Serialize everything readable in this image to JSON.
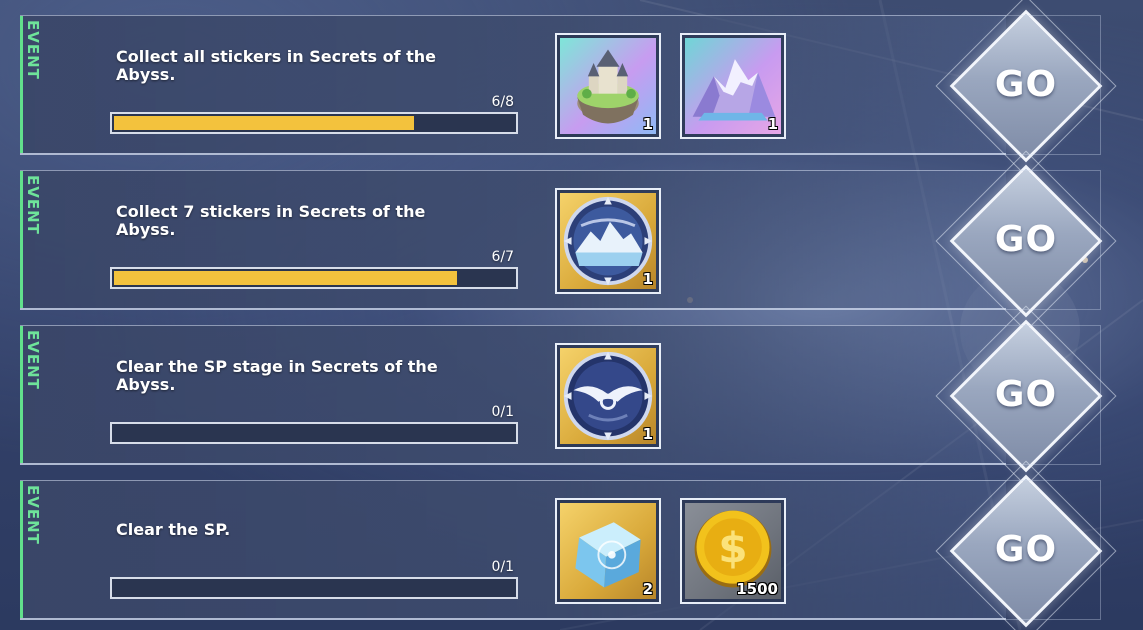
{
  "quests": [
    {
      "tag": "EVENT",
      "title": "Collect all stickers in Secrets of the Abyss.",
      "progress_text": "6/8",
      "progress": 0.75,
      "rewards": [
        {
          "icon": "floating-castle-island-icon",
          "count": "1"
        },
        {
          "icon": "crystal-mountain-icon",
          "count": "1"
        }
      ],
      "go_label": "GO"
    },
    {
      "tag": "EVENT",
      "title": "Collect 7 stickers in Secrets of the Abyss.",
      "progress_text": "6/7",
      "progress": 0.857,
      "rewards": [
        {
          "icon": "snowy-mountain-badge-icon",
          "count": "1"
        }
      ],
      "go_label": "GO"
    },
    {
      "tag": "EVENT",
      "title": "Clear the SP stage in Secrets of the Abyss.",
      "progress_text": "0/1",
      "progress": 0,
      "rewards": [
        {
          "icon": "winged-emblem-badge-icon",
          "count": "1"
        }
      ],
      "go_label": "GO"
    },
    {
      "tag": "EVENT",
      "title": "Clear the SP.",
      "progress_text": "0/1",
      "progress": 0,
      "rewards": [
        {
          "icon": "ice-cube-icon",
          "count": "2"
        },
        {
          "icon": "gold-coin-icon",
          "count": "1500"
        }
      ],
      "go_label": "GO"
    }
  ],
  "colors": {
    "event_accent": "#62e08c",
    "progress_fill": "#f3c23d",
    "rare_frame": "#d9a93a"
  }
}
